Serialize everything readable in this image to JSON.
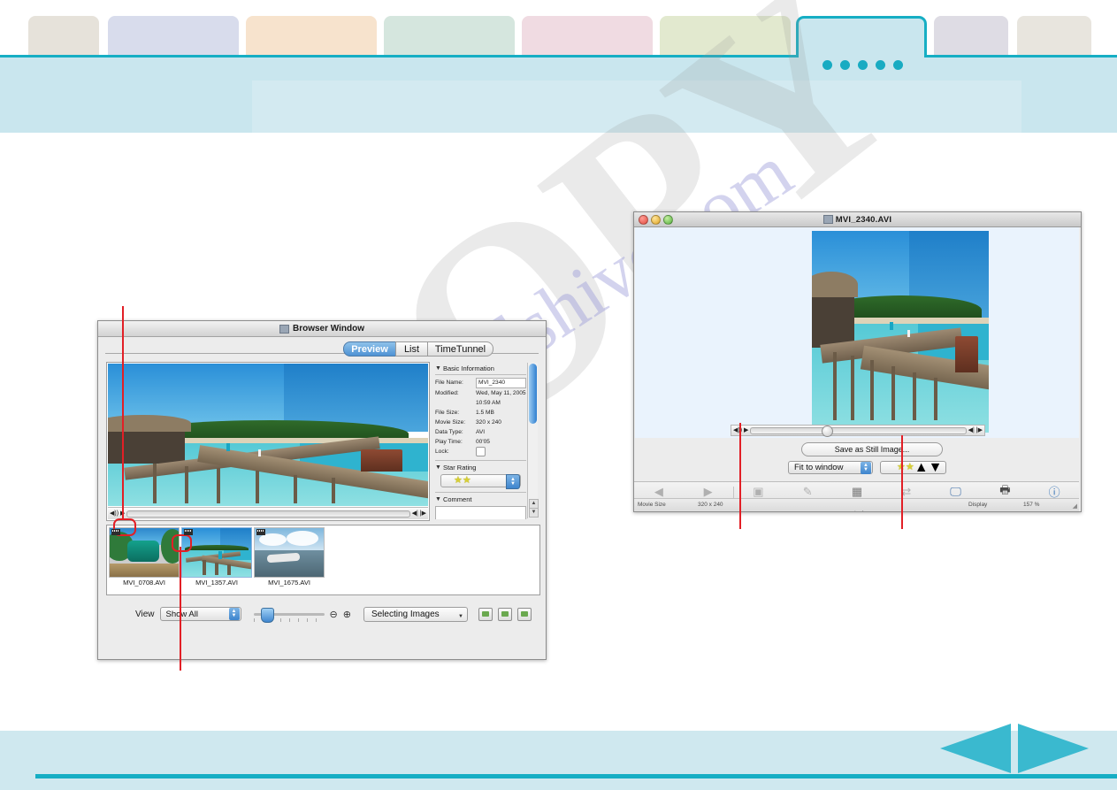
{
  "manual": {
    "tab_colors": [
      "#e6e2da",
      "#d8dcec",
      "#f7e3cd",
      "#d5e6de",
      "#f0dbe2",
      "#e2e9cf",
      "#c9e6ee",
      "#dedce4",
      "#e8e5de"
    ],
    "accent_color": "#16aec4",
    "header_bg": "#c9e6ee",
    "dot_count": 5,
    "nav_prev_icon": "triangle-left-icon",
    "nav_next_icon": "triangle-right-icon"
  },
  "watermark": {
    "copy_text": "COPY",
    "site_text": "manualshive.com"
  },
  "browser_window": {
    "title": "Browser Window",
    "tabs": [
      {
        "label": "Preview",
        "active": true
      },
      {
        "label": "List",
        "active": false
      },
      {
        "label": "TimeTunnel",
        "active": false
      }
    ],
    "player": {
      "volume_icon": "speaker-icon",
      "play_icon": "play-icon",
      "step_back_icon": "step-back-icon",
      "step_fwd_icon": "step-forward-icon"
    },
    "info": {
      "basic_title": "Basic Information",
      "fields": [
        {
          "key": "File Name:",
          "value": "MVI_2340",
          "editable": true
        },
        {
          "key": "Modified:",
          "value": "Wed, May 11, 2005 10:59 AM",
          "editable": false
        },
        {
          "key": "File Size:",
          "value": "1.5 MB",
          "editable": false
        },
        {
          "key": "Movie Size:",
          "value": "320 x 240",
          "editable": false
        },
        {
          "key": "Data Type:",
          "value": "AVI",
          "editable": false
        },
        {
          "key": "Play Time:",
          "value": "00'05",
          "editable": false
        },
        {
          "key": "Lock:",
          "value": "",
          "editable": false
        }
      ],
      "star_title": "Star Rating",
      "star_count": 2,
      "comment_title": "Comment"
    },
    "thumbnails": [
      {
        "name": "MVI_0708.AVI",
        "selected": false
      },
      {
        "name": "MVI_1357.AVI",
        "selected": true
      },
      {
        "name": "MVI_1675.AVI",
        "selected": false
      }
    ],
    "footer": {
      "view_label": "View",
      "view_value": "Show All",
      "zoom_out_icon": "magnifier-minus-icon",
      "zoom_in_icon": "magnifier-plus-icon",
      "selecting_label": "Selecting Images",
      "action_icons": [
        "export-icon",
        "download-icon",
        "share-icon"
      ]
    }
  },
  "viewer_window": {
    "title": "MVI_2340.AVI",
    "still_button": "Save as Still Image...",
    "fit_value": "Fit to window",
    "star_count": 2,
    "toolbar": [
      {
        "label": "Back",
        "icon": "arrow-left-icon",
        "dim": true
      },
      {
        "label": "Next",
        "icon": "arrow-right-icon",
        "dim": true
      },
      {
        "label": "Save",
        "icon": "save-icon",
        "dim": true
      },
      {
        "label": "Edit",
        "icon": "edit-icon",
        "dim": true,
        "caret": true
      },
      {
        "label": "Number of Displays",
        "icon": "grid-icon",
        "dim": false,
        "caret": true
      },
      {
        "label": "Synchronize",
        "icon": "sync-icon",
        "dim": true
      },
      {
        "label": "Full Screen",
        "icon": "fullscreen-icon",
        "dim": false
      },
      {
        "label": "Print",
        "icon": "printer-icon",
        "dim": false
      },
      {
        "label": "Show Information",
        "icon": "info-icon",
        "dim": false,
        "caret": true
      }
    ],
    "status": {
      "movie_size_label": "Movie Size",
      "movie_size_value": "320 x 240",
      "display_label": "Display",
      "display_value": "157 %"
    }
  }
}
